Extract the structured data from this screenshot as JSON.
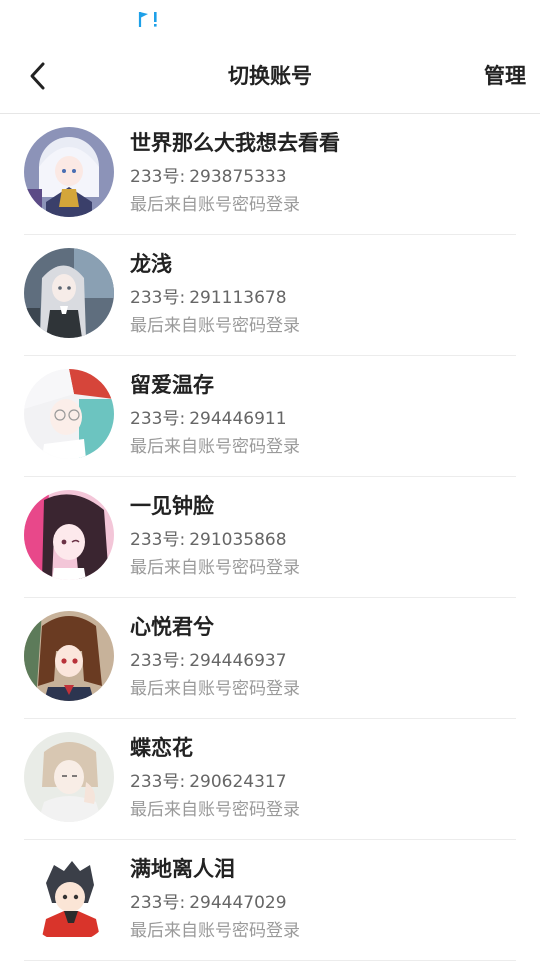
{
  "header": {
    "title": "切换账号",
    "manage_label": "管理"
  },
  "status_bar": {
    "icon": "flag-notification-icon",
    "accent": "#1ea0e8"
  },
  "accounts": [
    {
      "name": "世界那么大我想去看看",
      "id_prefix": "233号:",
      "id": "293875333",
      "login_source": "最后来自账号密码登录",
      "avatar": "anime-avatar-silver-hair"
    },
    {
      "name": "龙浅",
      "id_prefix": "233号:",
      "id": "291113678",
      "login_source": "最后来自账号密码登录",
      "avatar": "anime-avatar-gray-hair"
    },
    {
      "name": "留爱温存",
      "id_prefix": "233号:",
      "id": "294446911",
      "login_source": "最后来自账号密码登录",
      "avatar": "anime-avatar-red-white-hair"
    },
    {
      "name": "一见钟脸",
      "id_prefix": "233号:",
      "id": "291035868",
      "login_source": "最后来自账号密码登录",
      "avatar": "anime-avatar-pink-dark-hair"
    },
    {
      "name": "心悦君兮",
      "id_prefix": "233号:",
      "id": "294446937",
      "login_source": "最后来自账号密码登录",
      "avatar": "anime-avatar-brown-hair"
    },
    {
      "name": "蝶恋花",
      "id_prefix": "233号:",
      "id": "290624317",
      "login_source": "最后来自账号密码登录",
      "avatar": "anime-avatar-beige-hair"
    },
    {
      "name": "满地离人泪",
      "id_prefix": "233号:",
      "id": "294447029",
      "login_source": "最后来自账号密码登录",
      "avatar": "anime-avatar-red-hoodie"
    }
  ]
}
